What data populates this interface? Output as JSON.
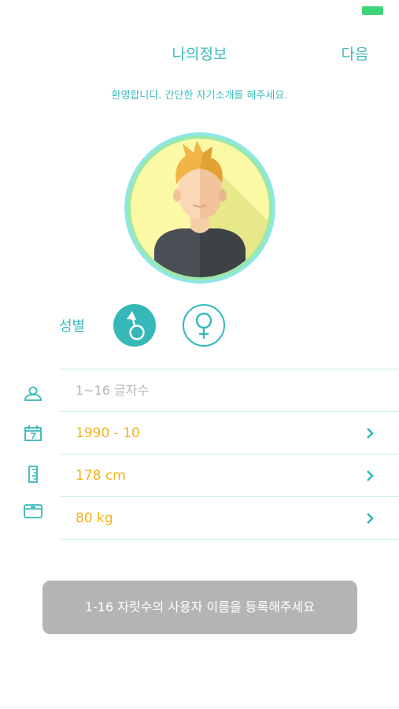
{
  "status_bar": {
    "battery_color": "#3fd37a"
  },
  "header": {
    "title": "나의정보",
    "next_label": "다음"
  },
  "welcome_text": "환영합니다. 간단한 자기소개를 해주세요.",
  "profile": {
    "avatar_icon": "male-avatar-illustration"
  },
  "gender": {
    "label": "성별",
    "options": [
      {
        "id": "male",
        "icon": "male-symbol-icon",
        "selected": true
      },
      {
        "id": "female",
        "icon": "female-symbol-icon",
        "selected": false
      }
    ]
  },
  "form": {
    "nickname": {
      "icon": "user-icon",
      "placeholder": "1~16 글자수",
      "value": ""
    },
    "birth": {
      "icon": "calendar-icon",
      "value": "1990 - 10"
    },
    "height": {
      "icon": "ruler-icon",
      "value": "178 cm"
    },
    "weight": {
      "icon": "scale-icon",
      "value": "80 kg"
    }
  },
  "toast": {
    "message": "1-16 자릿수의 사용자 이름을 등록해주세요"
  },
  "colors": {
    "accent": "#36b8b8",
    "value_text": "#f2b31a",
    "placeholder": "#b6b6b6",
    "toast_bg": "#b4b4b4"
  }
}
